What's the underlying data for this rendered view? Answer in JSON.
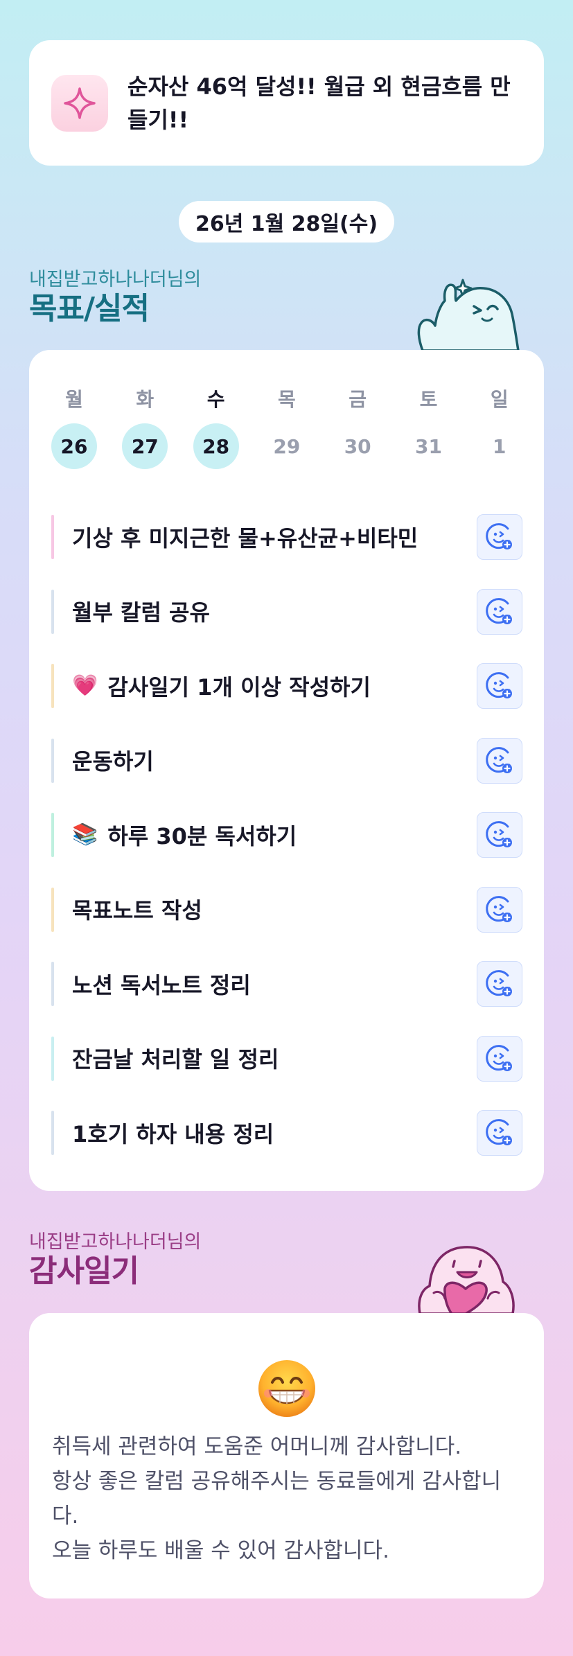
{
  "goal": {
    "icon": "sparkle-icon",
    "text": "순자산 46억 달성!! 월급 외 현금흐름 만들기!!"
  },
  "date_label": "26년 1월 28일(수)",
  "goals_section": {
    "subtitle": "내집받고하나나더님의",
    "title": "목표/실적"
  },
  "week": {
    "weekdays": [
      "월",
      "화",
      "수",
      "목",
      "금",
      "토",
      "일"
    ],
    "days": [
      "26",
      "27",
      "28",
      "29",
      "30",
      "31",
      "1"
    ],
    "done_days": [
      0,
      1,
      2
    ],
    "today_index": 2
  },
  "tasks": [
    {
      "label": "기상 후 미지근한 물+유산균+비타민",
      "emoji": "",
      "bar_color": "#f7c7e4"
    },
    {
      "label": "월부 칼럼 공유",
      "emoji": "",
      "bar_color": "#d8e2ee"
    },
    {
      "label": "감사일기 1개 이상 작성하기",
      "emoji": "💗",
      "bar_color": "#f7e3bd"
    },
    {
      "label": "운동하기",
      "emoji": "",
      "bar_color": "#d8e2ee"
    },
    {
      "label": "하루 30분 독서하기",
      "emoji": "📚",
      "bar_color": "#bff0df"
    },
    {
      "label": "목표노트 작성",
      "emoji": "",
      "bar_color": "#f7e3bd"
    },
    {
      "label": "노션 독서노트 정리",
      "emoji": "",
      "bar_color": "#d8e2ee"
    },
    {
      "label": "잔금날 처리할 일 정리",
      "emoji": "",
      "bar_color": "#c9eff1"
    },
    {
      "label": "1호기 하자 내용 정리",
      "emoji": "",
      "bar_color": "#d8e2ee"
    }
  ],
  "task_action_icon": "add-reaction-icon",
  "thanks_section": {
    "subtitle": "내집받고하나나더님의",
    "title": "감사일기"
  },
  "thanks": {
    "emoji_icon": "grinning-face-icon",
    "lines": [
      "취득세 관련하여 도움준 어머니께 감사합니다.",
      "항상 좋은 칼럼 공유해주시는 동료들에게 감사합니다.",
      "오늘 하루도 배울 수 있어 감사합니다."
    ]
  },
  "colors": {
    "accent_cyan": "#c8f0f4",
    "goal_title": "#166f82",
    "thanks_title": "#8b2c79",
    "reaction_blue": "#3d6ff2"
  }
}
